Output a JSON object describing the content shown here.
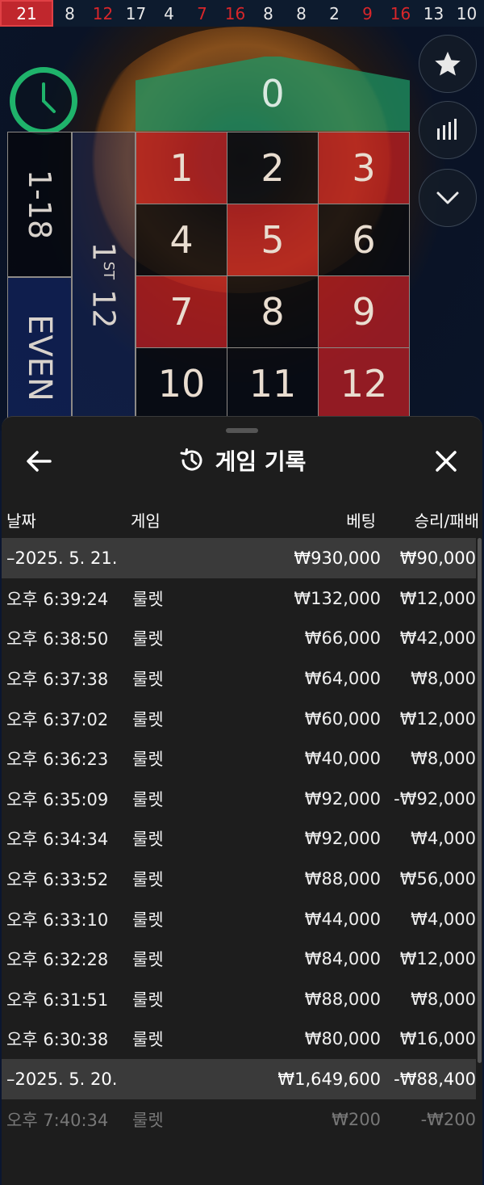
{
  "results_strip": [
    {
      "value": "21",
      "color": "red",
      "latest": true
    },
    {
      "value": "8",
      "color": "black"
    },
    {
      "value": "12",
      "color": "red"
    },
    {
      "value": "17",
      "color": "black"
    },
    {
      "value": "4",
      "color": "black"
    },
    {
      "value": "7",
      "color": "red"
    },
    {
      "value": "16",
      "color": "red"
    },
    {
      "value": "8",
      "color": "black"
    },
    {
      "value": "8",
      "color": "black"
    },
    {
      "value": "2",
      "color": "black"
    },
    {
      "value": "9",
      "color": "red"
    },
    {
      "value": "16",
      "color": "red"
    },
    {
      "value": "13",
      "color": "black"
    },
    {
      "value": "10",
      "color": "black"
    }
  ],
  "betting_table": {
    "zero": "0",
    "numbers": [
      {
        "n": "1",
        "c": "r"
      },
      {
        "n": "2",
        "c": "b"
      },
      {
        "n": "3",
        "c": "r"
      },
      {
        "n": "4",
        "c": "b"
      },
      {
        "n": "5",
        "c": "r"
      },
      {
        "n": "6",
        "c": "b"
      },
      {
        "n": "7",
        "c": "r"
      },
      {
        "n": "8",
        "c": "b"
      },
      {
        "n": "9",
        "c": "r"
      },
      {
        "n": "10",
        "c": "b"
      },
      {
        "n": "11",
        "c": "b"
      },
      {
        "n": "12",
        "c": "r"
      }
    ],
    "low_label": "1-18",
    "even_label": "EVEN",
    "dozen_label": "1",
    "dozen_suffix": "ST",
    "dozen_number": "12"
  },
  "colors": {
    "accent_green": "#1fb36b",
    "red": "#c0272d",
    "panel_bg": "#1d1d1d"
  },
  "icons": {
    "clock": "clock-icon",
    "favorite": "star-icon",
    "stats": "bar-chart-icon",
    "collapse": "chevron-down-icon",
    "back": "arrow-left-icon",
    "history": "history-icon",
    "close": "close-icon"
  },
  "panel": {
    "title": "게임 기록",
    "columns": {
      "date": "날짜",
      "game": "게임",
      "bet": "베팅",
      "win_loss": "승리/패배"
    }
  },
  "groups": [
    {
      "date": "–2025. 5. 21.",
      "bet_total": "₩930,000",
      "win_total": "₩90,000",
      "rows": [
        {
          "time": "오후 6:39:24",
          "game": "룰렛",
          "bet": "₩132,000",
          "win": "₩12,000"
        },
        {
          "time": "오후 6:38:50",
          "game": "룰렛",
          "bet": "₩66,000",
          "win": "₩42,000"
        },
        {
          "time": "오후 6:37:38",
          "game": "룰렛",
          "bet": "₩64,000",
          "win": "₩8,000"
        },
        {
          "time": "오후 6:37:02",
          "game": "룰렛",
          "bet": "₩60,000",
          "win": "₩12,000"
        },
        {
          "time": "오후 6:36:23",
          "game": "룰렛",
          "bet": "₩40,000",
          "win": "₩8,000"
        },
        {
          "time": "오후 6:35:09",
          "game": "룰렛",
          "bet": "₩92,000",
          "win": "-₩92,000"
        },
        {
          "time": "오후 6:34:34",
          "game": "룰렛",
          "bet": "₩92,000",
          "win": "₩4,000"
        },
        {
          "time": "오후 6:33:52",
          "game": "룰렛",
          "bet": "₩88,000",
          "win": "₩56,000"
        },
        {
          "time": "오후 6:33:10",
          "game": "룰렛",
          "bet": "₩44,000",
          "win": "₩4,000"
        },
        {
          "time": "오후 6:32:28",
          "game": "룰렛",
          "bet": "₩84,000",
          "win": "₩12,000"
        },
        {
          "time": "오후 6:31:51",
          "game": "룰렛",
          "bet": "₩88,000",
          "win": "₩8,000"
        },
        {
          "time": "오후 6:30:38",
          "game": "룰렛",
          "bet": "₩80,000",
          "win": "₩16,000"
        }
      ]
    },
    {
      "date": "–2025. 5. 20.",
      "bet_total": "₩1,649,600",
      "win_total": "-₩88,400",
      "rows": [
        {
          "time": "오후 7:40:34",
          "game": "룰렛",
          "bet": "₩200",
          "win": "-₩200",
          "faded": true
        }
      ]
    }
  ]
}
